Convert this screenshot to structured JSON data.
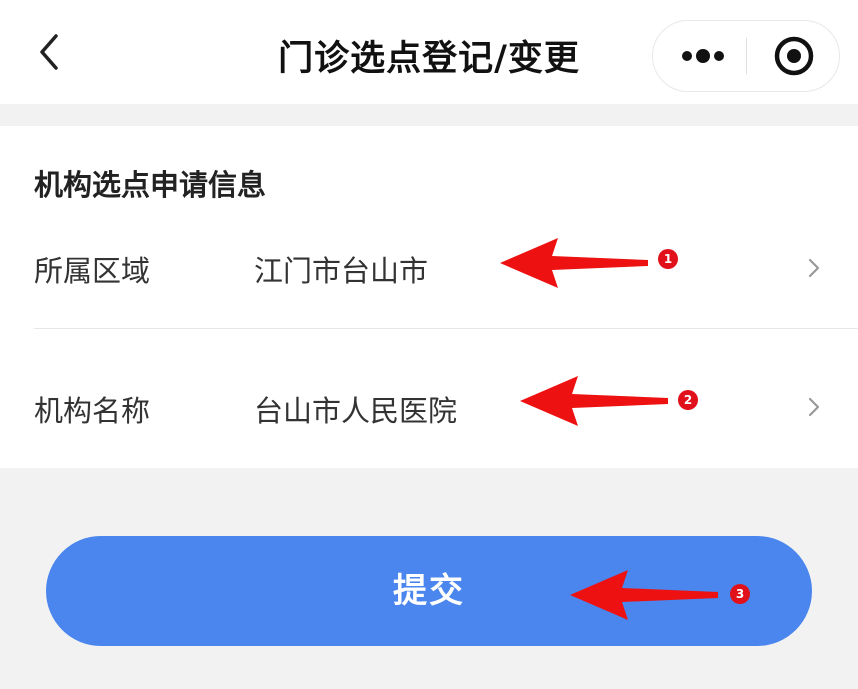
{
  "nav": {
    "title": "门诊选点登记/变更",
    "back_icon": "chevron-left-icon",
    "more_icon": "more-dots-icon",
    "target_icon": "target-icon"
  },
  "form": {
    "section_title": "机构选点申请信息",
    "rows": [
      {
        "label": "所属区域",
        "value": "江门市台山市"
      },
      {
        "label": "机构名称",
        "value": "台山市人民医院"
      }
    ]
  },
  "submit_label": "提交",
  "annotations": [
    {
      "number": "1"
    },
    {
      "number": "2"
    },
    {
      "number": "3"
    }
  ],
  "colors": {
    "primary": "#4a86ee",
    "annotation": "#e0111b",
    "background": "#f2f2f2"
  }
}
